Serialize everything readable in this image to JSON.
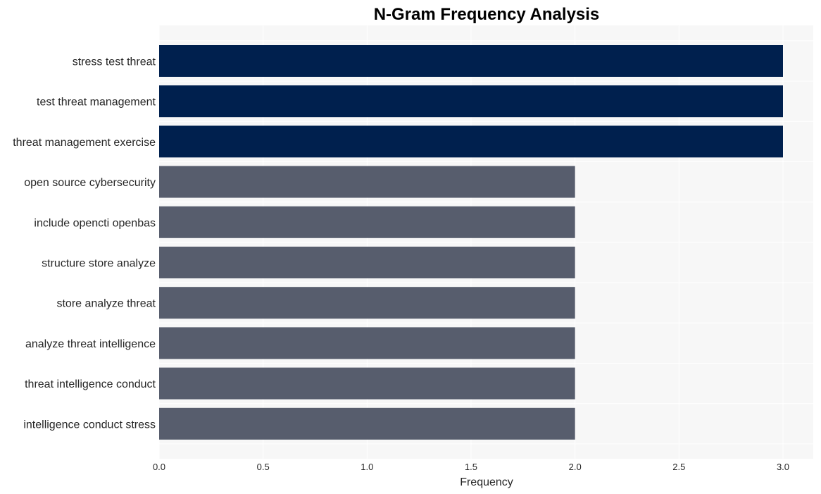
{
  "chart_data": {
    "type": "bar",
    "orientation": "horizontal",
    "title": "N-Gram Frequency Analysis",
    "xlabel": "Frequency",
    "ylabel": "",
    "xlim": [
      0,
      3.15
    ],
    "xticks": [
      "0.0",
      "0.5",
      "1.0",
      "1.5",
      "2.0",
      "2.5",
      "3.0"
    ],
    "xtick_values": [
      0,
      0.5,
      1.0,
      1.5,
      2.0,
      2.5,
      3.0
    ],
    "grid": true,
    "categories": [
      "stress test threat",
      "test threat management",
      "threat management exercise",
      "open source cybersecurity",
      "include opencti openbas",
      "structure store analyze",
      "store analyze threat",
      "analyze threat intelligence",
      "threat intelligence conduct",
      "intelligence conduct stress"
    ],
    "values": [
      3,
      3,
      3,
      2,
      2,
      2,
      2,
      2,
      2,
      2
    ],
    "colors": {
      "top": "#00204e",
      "other": "#575d6d",
      "plot_background": "#f7f7f7",
      "grid": "#ffffff"
    }
  }
}
